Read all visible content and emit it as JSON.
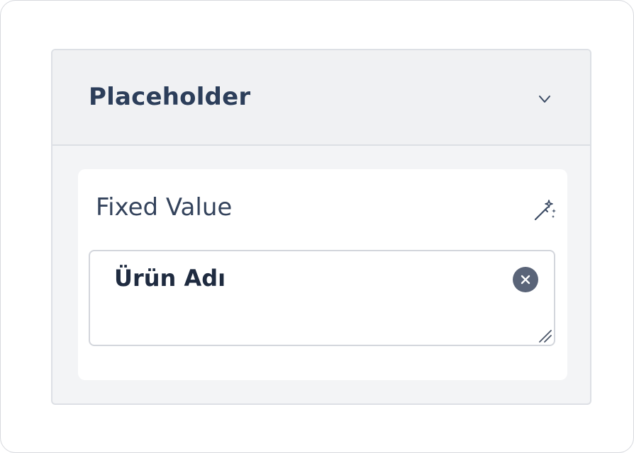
{
  "section": {
    "title": "Placeholder",
    "toggle_icon": "chevron-down-icon",
    "expanded": true
  },
  "field": {
    "label": "Fixed Value",
    "magic_icon": "magic-wand-icon",
    "value": "Ürün Adı",
    "clear_icon": "close-icon",
    "resize_icon": "resize-handle-icon"
  },
  "colors": {
    "title": "#2c3e5a",
    "label": "#34435c",
    "value": "#1f2b40",
    "clear_button": "#5a6478",
    "panel_bg": "#f3f4f6",
    "card_bg": "#ffffff"
  }
}
